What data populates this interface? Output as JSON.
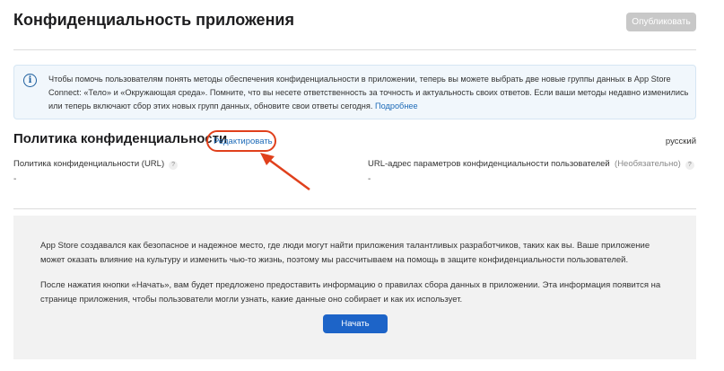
{
  "header": {
    "title": "Конфиденциальность приложения",
    "publish_label": "Опубликовать"
  },
  "info": {
    "text": "Чтобы помочь пользователям понять методы обеспечения конфиденциальности в приложении, теперь вы можете выбрать две новые группы данных в App Store Connect: «Тело» и «Окружающая среда». Помните, что вы несете ответственность за точность и актуальность своих ответов. Если ваши методы недавно изменились или теперь включают сбор этих новых групп данных, обновите свои ответы сегодня.",
    "link": "Подробнее"
  },
  "policy": {
    "title": "Политика конфиденциальности",
    "edit_label": "Редактировать",
    "language": "русский",
    "url_label": "Политика конфиденциальности (URL)",
    "url_value": "-",
    "choices_label": "URL-адрес параметров конфиденциальности пользователей",
    "optional": "(Необязательно)",
    "choices_value": "-",
    "help": "?"
  },
  "intro": {
    "p1": "App Store создавался как безопасное и надежное место, где люди могут найти приложения талантливых разработчиков, таких как вы. Ваше приложение может оказать влияние на культуру и изменить чью-то жизнь, поэтому мы рассчитываем на помощь в защите конфиденциальности пользователей.",
    "p2": "После нажатия кнопки «Начать», вам будет предложено предоставить информацию о правилах сбора данных в приложении. Эта информация появится на странице приложения, чтобы пользователи могли узнать, какие данные оно собирает и как их использует.",
    "start_label": "Начать"
  }
}
